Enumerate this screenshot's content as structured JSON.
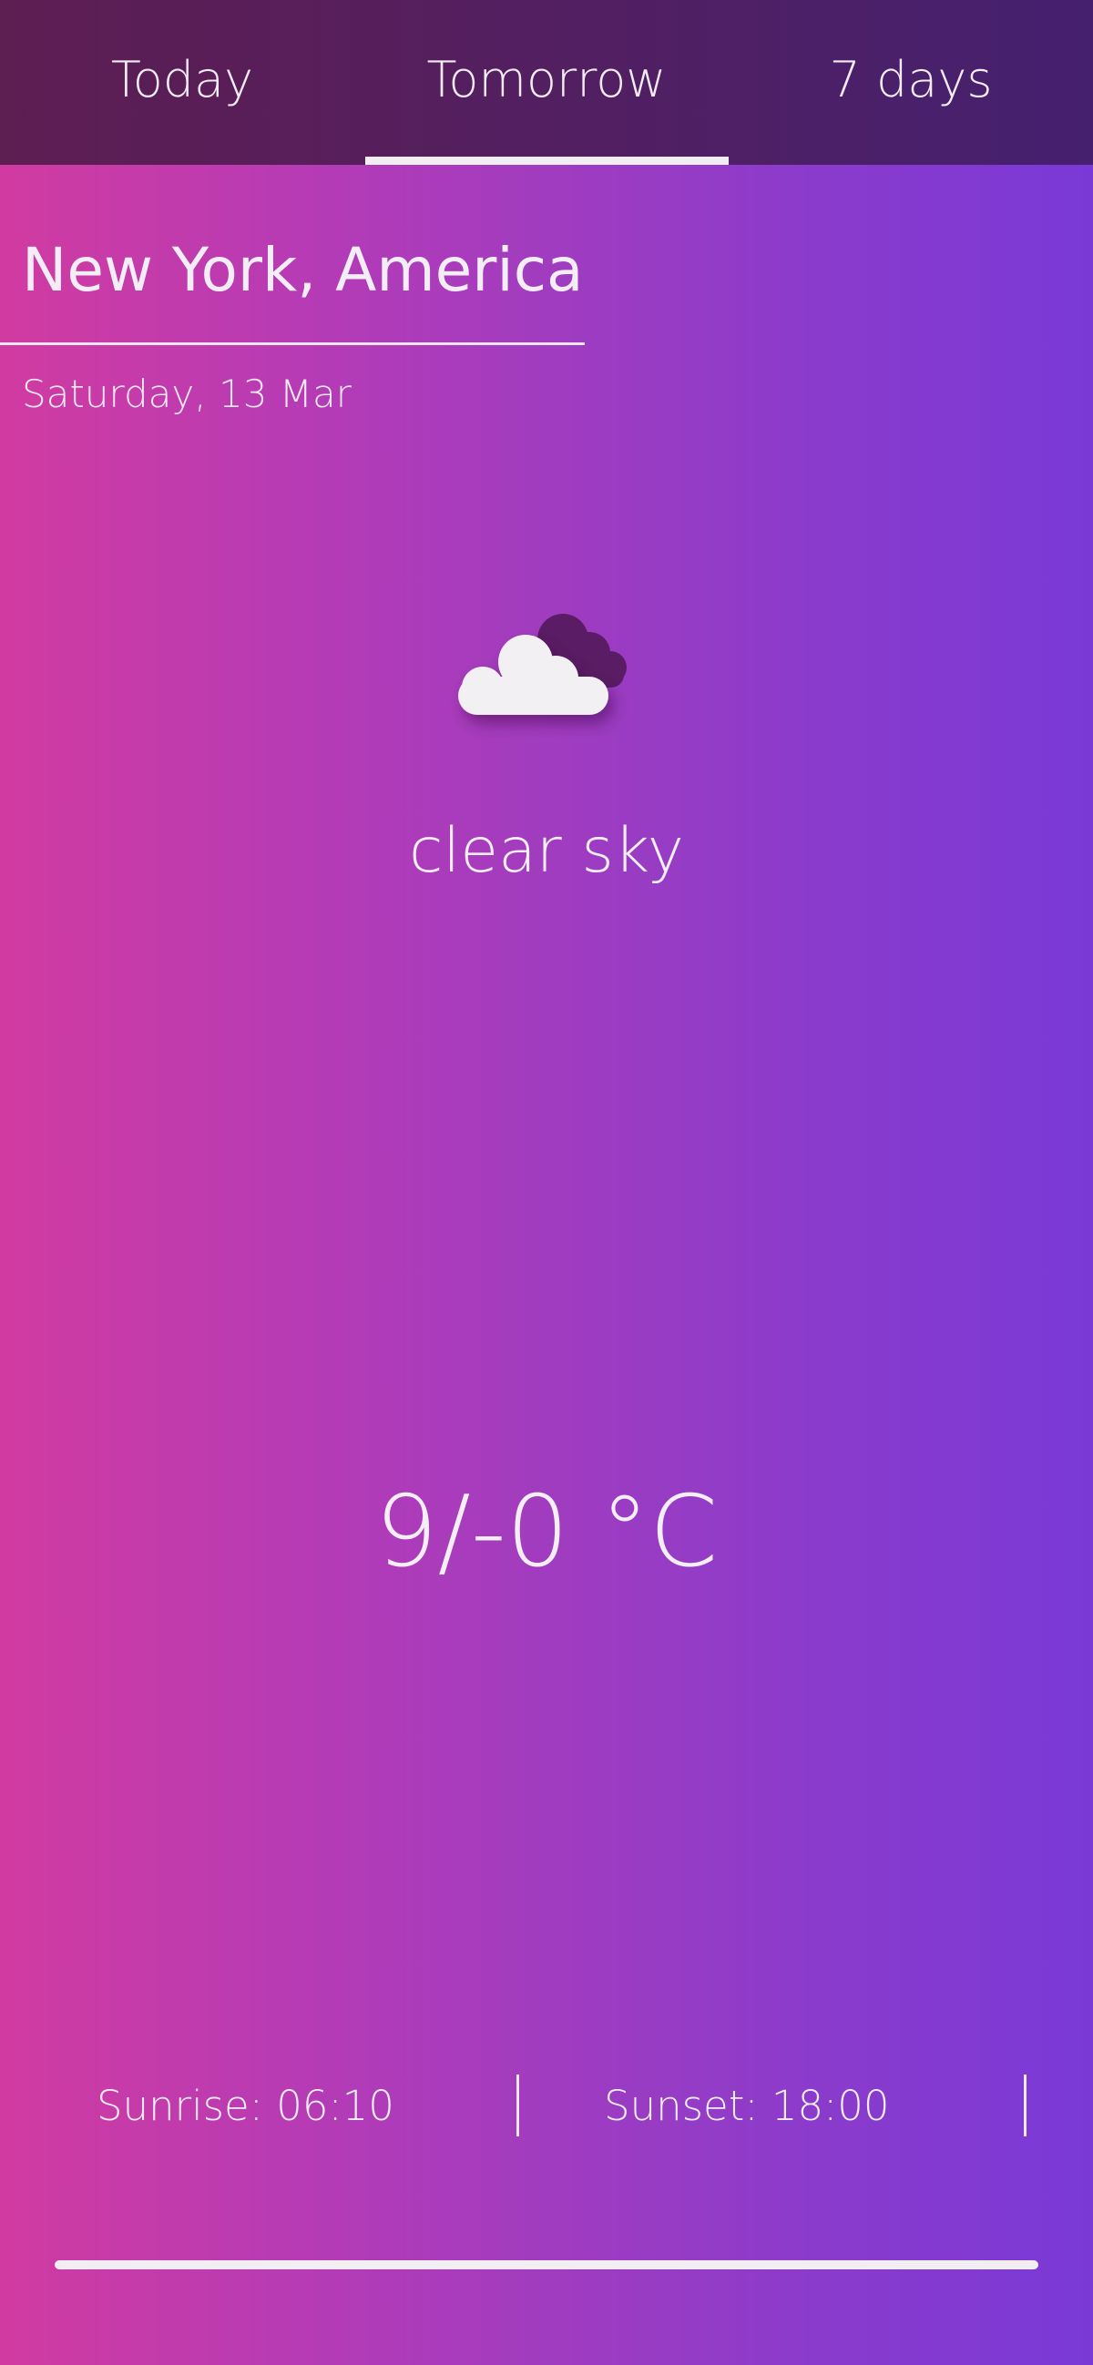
{
  "tabs": [
    {
      "label": "Today",
      "selected": false
    },
    {
      "label": "Tomorrow",
      "selected": true
    },
    {
      "label": "7 days",
      "selected": false
    }
  ],
  "location": {
    "city": "New York, America",
    "date": "Saturday, 13 Mar"
  },
  "weather": {
    "icon": "cloud-icon",
    "condition": "clear sky",
    "temperature": "9/-0 °C"
  },
  "sun": {
    "sunrise": "Sunrise: 06:10",
    "sunset": "Sunset: 18:00"
  },
  "colors": {
    "gradient_left": "#d13ba1",
    "gradient_right": "#7a39d6",
    "tabbar": "#541f5f",
    "cloud_front": "#f2f0f2",
    "cloud_back": "#5a1c64"
  }
}
